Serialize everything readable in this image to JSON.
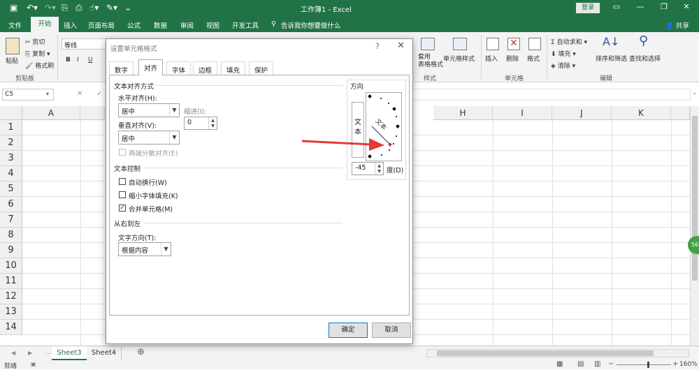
{
  "app": {
    "title": "工作簿1 - Excel",
    "login": "登录",
    "share": "共享",
    "colors": {
      "brand": "#217346",
      "arrow": "#e53935"
    }
  },
  "ribbon_tabs": [
    "文件",
    "开始",
    "插入",
    "页面布局",
    "公式",
    "数据",
    "审阅",
    "视图",
    "开发工具"
  ],
  "tell_me": "告诉我你想要做什么",
  "clipboard": {
    "paste": "粘贴",
    "cut": "剪切",
    "copy": "复制",
    "format_painter": "格式刷",
    "group": "剪贴板"
  },
  "font": {
    "name": "等线",
    "bold": "B",
    "italic": "I",
    "underline": "U"
  },
  "styles": {
    "table_format": "套用\n表格格式",
    "cell_style": "单元格样式",
    "group": "样式"
  },
  "cells": {
    "insert": "插入",
    "delete": "删除",
    "format": "格式",
    "group": "单元格"
  },
  "editing": {
    "autosum": "自动求和",
    "fill": "填充",
    "clear": "清除",
    "sort_filter": "排序和筛选",
    "find_select": "查找和选择",
    "group": "编辑"
  },
  "name_box": "C5",
  "columns_visible": [
    "A",
    "H",
    "I",
    "J",
    "K"
  ],
  "rows": [
    "1",
    "2",
    "3",
    "4",
    "5",
    "6",
    "7",
    "8",
    "9",
    "10",
    "11",
    "12",
    "13",
    "14"
  ],
  "sheet_tabs": [
    "Sheet3",
    "Sheet4"
  ],
  "status": {
    "ready": "就绪",
    "zoom": "160%"
  },
  "dialog": {
    "title": "设置单元格格式",
    "help": "?",
    "close": "✕",
    "tabs": [
      "数字",
      "对齐",
      "字体",
      "边框",
      "填充",
      "保护"
    ],
    "text_alignment_section": "文本对齐方式",
    "horizontal_label": "水平对齐(H):",
    "horizontal_value": "居中",
    "indent_label": "缩进(I):",
    "indent_value": "0",
    "vertical_label": "垂直对齐(V):",
    "vertical_value": "居中",
    "justify_distributed": "两端分散对齐(E)",
    "text_control_section": "文本控制",
    "wrap_text": "自动换行(W)",
    "shrink_to_fit": "缩小字体填充(K)",
    "merge_cells": "合并单元格(M)",
    "rtl_section": "从右到左",
    "text_direction_label": "文字方向(T):",
    "text_direction_value": "根据内容",
    "orientation_section": "方向",
    "orientation_vertical_text": "文\n本",
    "orientation_sample": "文本",
    "degrees_value": "-45",
    "degrees_label": "度(D)",
    "ok": "确定",
    "cancel": "取消",
    "checks": {
      "justify_distributed": false,
      "wrap_text": false,
      "shrink_to_fit": false,
      "merge_cells": true
    }
  }
}
